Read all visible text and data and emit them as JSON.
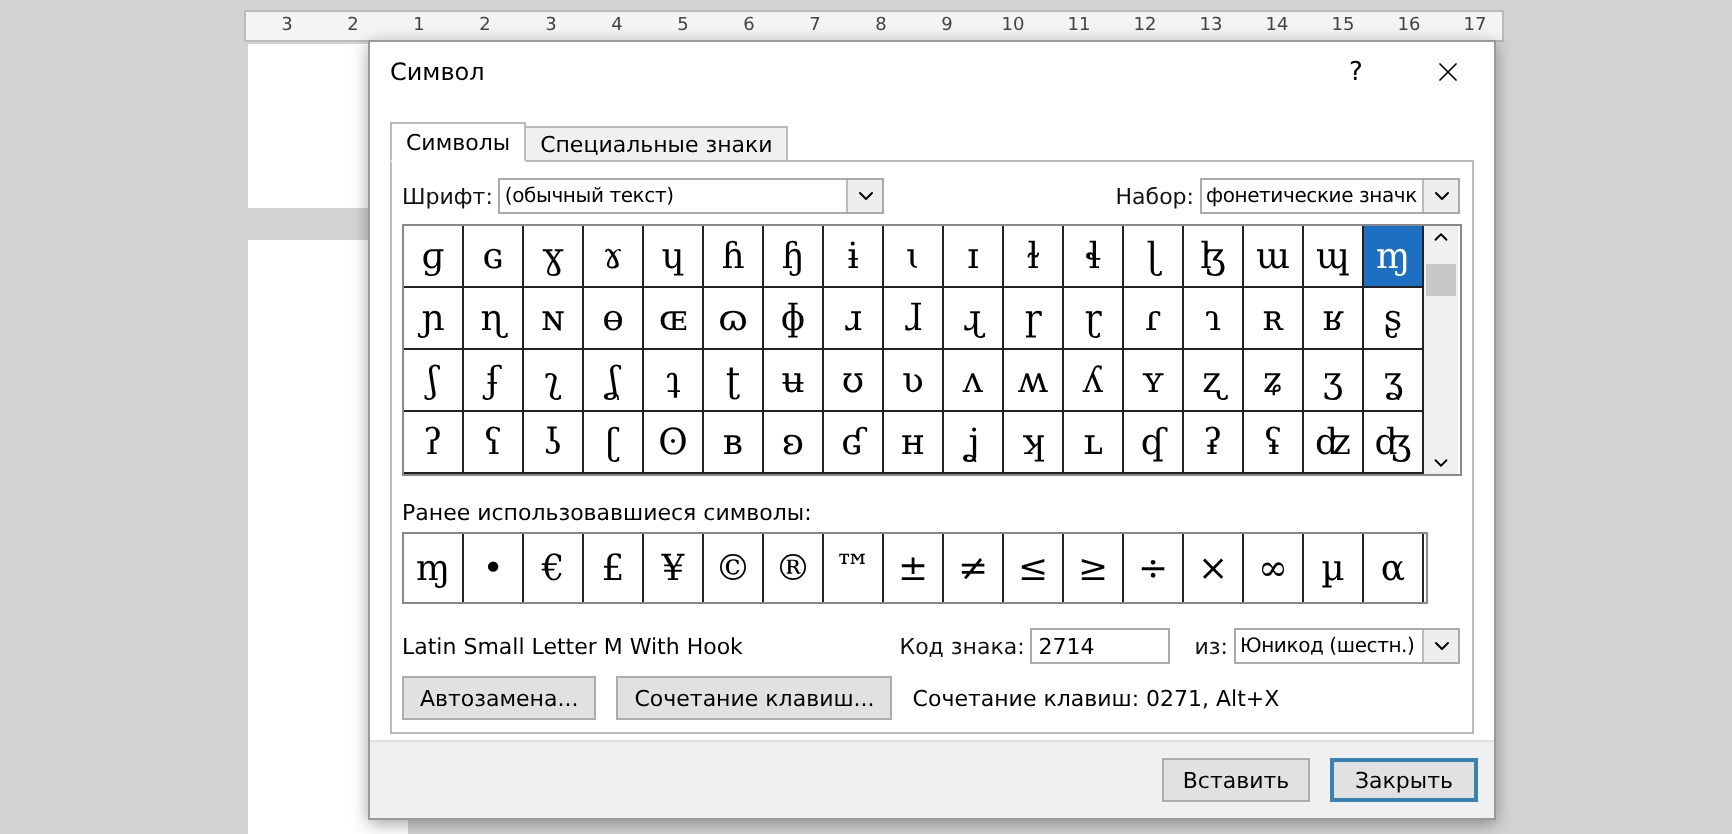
{
  "ruler": {
    "labels": [
      "3",
      "2",
      "1",
      "2",
      "3",
      "4",
      "5",
      "6",
      "7",
      "8",
      "9",
      "10",
      "11",
      "12",
      "13",
      "14",
      "15",
      "16",
      "17"
    ]
  },
  "dialog": {
    "title": "Символ",
    "help": "?"
  },
  "tabs": [
    {
      "label": "Символы",
      "selected": true
    },
    {
      "label": "Специальные знаки",
      "selected": false
    }
  ],
  "font": {
    "label": "Шрифт:",
    "value": "(обычный текст)"
  },
  "subset": {
    "label": "Набор:",
    "value": "фонетические значк"
  },
  "grid": {
    "rows": [
      [
        {
          "char": "ɡ",
          "selected": false
        },
        {
          "char": "ɢ",
          "selected": false
        },
        {
          "char": "ɣ",
          "selected": false
        },
        {
          "char": "ɤ",
          "selected": false
        },
        {
          "char": "ɥ",
          "selected": false
        },
        {
          "char": "ɦ",
          "selected": false
        },
        {
          "char": "ɧ",
          "selected": false
        },
        {
          "char": "ɨ",
          "selected": false
        },
        {
          "char": "ɩ",
          "selected": false
        },
        {
          "char": "ɪ",
          "selected": false
        },
        {
          "char": "ɫ",
          "selected": false
        },
        {
          "char": "ɬ",
          "selected": false
        },
        {
          "char": "ɭ",
          "selected": false
        },
        {
          "char": "ɮ",
          "selected": false
        },
        {
          "char": "ɯ",
          "selected": false
        },
        {
          "char": "ɰ",
          "selected": false
        },
        {
          "char": "ɱ",
          "selected": true
        }
      ],
      [
        {
          "char": "ɲ",
          "selected": false
        },
        {
          "char": "ɳ",
          "selected": false
        },
        {
          "char": "ɴ",
          "selected": false
        },
        {
          "char": "ɵ",
          "selected": false
        },
        {
          "char": "ɶ",
          "selected": false
        },
        {
          "char": "ɷ",
          "selected": false
        },
        {
          "char": "ɸ",
          "selected": false
        },
        {
          "char": "ɹ",
          "selected": false
        },
        {
          "char": "ɺ",
          "selected": false
        },
        {
          "char": "ɻ",
          "selected": false
        },
        {
          "char": "ɼ",
          "selected": false
        },
        {
          "char": "ɽ",
          "selected": false
        },
        {
          "char": "ɾ",
          "selected": false
        },
        {
          "char": "ɿ",
          "selected": false
        },
        {
          "char": "ʀ",
          "selected": false
        },
        {
          "char": "ʁ",
          "selected": false
        },
        {
          "char": "ʂ",
          "selected": false
        }
      ],
      [
        {
          "char": "ʃ",
          "selected": false
        },
        {
          "char": "ʄ",
          "selected": false
        },
        {
          "char": "ʅ",
          "selected": false
        },
        {
          "char": "ʆ",
          "selected": false
        },
        {
          "char": "ʇ",
          "selected": false
        },
        {
          "char": "ʈ",
          "selected": false
        },
        {
          "char": "ʉ",
          "selected": false
        },
        {
          "char": "ʊ",
          "selected": false
        },
        {
          "char": "ʋ",
          "selected": false
        },
        {
          "char": "ʌ",
          "selected": false
        },
        {
          "char": "ʍ",
          "selected": false
        },
        {
          "char": "ʎ",
          "selected": false
        },
        {
          "char": "ʏ",
          "selected": false
        },
        {
          "char": "ʐ",
          "selected": false
        },
        {
          "char": "ʑ",
          "selected": false
        },
        {
          "char": "ʒ",
          "selected": false
        },
        {
          "char": "ʓ",
          "selected": false
        }
      ],
      [
        {
          "char": "ʔ",
          "selected": false
        },
        {
          "char": "ʕ",
          "selected": false
        },
        {
          "char": "ʖ",
          "selected": false
        },
        {
          "char": "ʗ",
          "selected": false
        },
        {
          "char": "ʘ",
          "selected": false
        },
        {
          "char": "ʙ",
          "selected": false
        },
        {
          "char": "ʚ",
          "selected": false
        },
        {
          "char": "ʛ",
          "selected": false
        },
        {
          "char": "ʜ",
          "selected": false
        },
        {
          "char": "ʝ",
          "selected": false
        },
        {
          "char": "ʞ",
          "selected": false
        },
        {
          "char": "ʟ",
          "selected": false
        },
        {
          "char": "ʠ",
          "selected": false
        },
        {
          "char": "ʡ",
          "selected": false
        },
        {
          "char": "ʢ",
          "selected": false
        },
        {
          "char": "ʣ",
          "selected": false
        },
        {
          "char": "ʤ",
          "selected": false
        }
      ]
    ]
  },
  "recent": {
    "label": "Ранее использовавшиеся символы:",
    "symbols": [
      "ɱ",
      "•",
      "€",
      "£",
      "¥",
      "©",
      "®",
      "™",
      "±",
      "≠",
      "≤",
      "≥",
      "÷",
      "×",
      "∞",
      "µ",
      "α"
    ]
  },
  "char_name": "Latin Small Letter M With Hook",
  "code": {
    "label": "Код знака:",
    "value": "2714"
  },
  "from": {
    "label": "из:",
    "value": "Юникод (шестн.)"
  },
  "buttons": [
    "Автозамена...",
    "Сочетание клавиш..."
  ],
  "shortcut": "Сочетание клавиш: 0271, Alt+X",
  "footer_buttons": [
    {
      "label": "Вставить",
      "default": false
    },
    {
      "label": "Закрыть",
      "default": true
    }
  ]
}
